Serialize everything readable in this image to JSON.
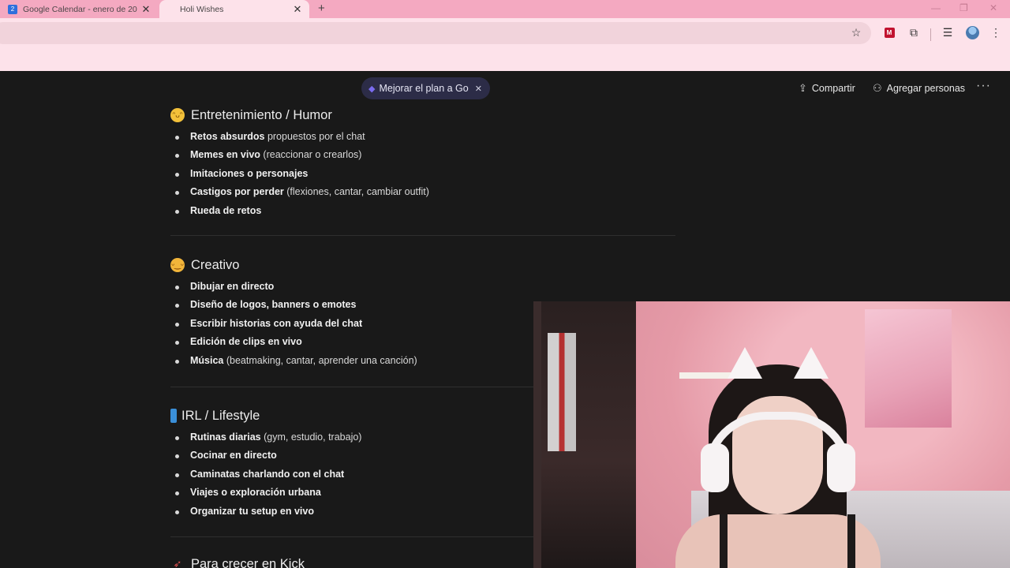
{
  "browser": {
    "tabs": [
      {
        "title": "Google Calendar - enero de 20",
        "favicon": "google-calendar-icon",
        "active": false
      },
      {
        "title": "Holi Wishes",
        "favicon": "",
        "active": true
      }
    ],
    "colors": {
      "tabbar": "#f4a9c1",
      "toolbar": "#fde2ea",
      "accent": "#7b6cf0"
    }
  },
  "notion": {
    "upgrade_pill": "Mejorar el plan a Go",
    "share_label": "Compartir",
    "add_people_label": "Agregar personas"
  },
  "sections": [
    {
      "title": "Entretenimiento / Humor",
      "emoji": "laughing-face-emoji",
      "items": [
        {
          "bold": "Retos absurdos",
          "rest": " propuestos por el chat"
        },
        {
          "bold": "Memes en vivo",
          "rest": " (reaccionar o crearlos)"
        },
        {
          "bold": "Imitaciones o personajes",
          "rest": ""
        },
        {
          "bold": "Castigos por perder",
          "rest": " (flexiones, cantar, cambiar outfit)"
        },
        {
          "bold": "Rueda de retos",
          "rest": ""
        }
      ]
    },
    {
      "title": "Creativo",
      "emoji": "creative-face-emoji",
      "items": [
        {
          "bold": "Dibujar en directo",
          "rest": ""
        },
        {
          "bold": "Diseño de logos, banners o emotes",
          "rest": ""
        },
        {
          "bold": "Escribir historias con ayuda del chat",
          "rest": ""
        },
        {
          "bold": "Edición de clips en vivo",
          "rest": ""
        },
        {
          "bold": "Música",
          "rest": " (beatmaking, cantar, aprender una canción)"
        }
      ]
    },
    {
      "title": "IRL / Lifestyle",
      "emoji": "phone-emoji",
      "items": [
        {
          "bold": "Rutinas diarias",
          "rest": " (gym, estudio, trabajo)"
        },
        {
          "bold": "Cocinar en directo",
          "rest": ""
        },
        {
          "bold": "Caminatas charlando con el chat",
          "rest": ""
        },
        {
          "bold": "Viajes o exploración urbana",
          "rest": ""
        },
        {
          "bold": "Organizar tu setup en vivo",
          "rest": ""
        }
      ]
    },
    {
      "title": "Para crecer en Kick",
      "emoji": "rocket-emoji",
      "items": []
    }
  ]
}
